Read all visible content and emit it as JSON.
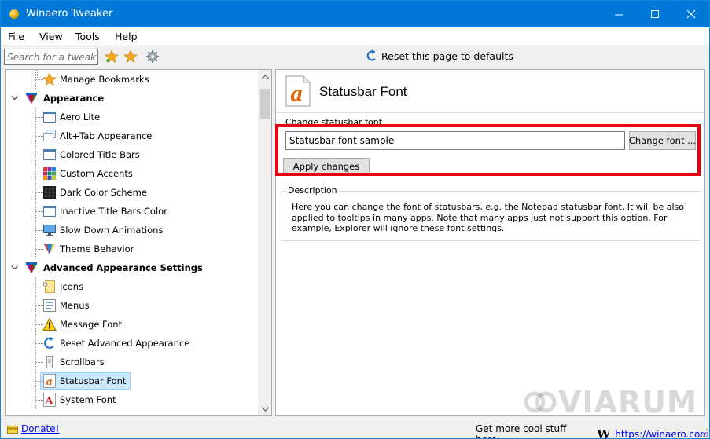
{
  "window": {
    "title": "Winaero Tweaker",
    "controls": {
      "minimize": "minimize",
      "maximize": "maximize",
      "close": "close"
    }
  },
  "menu": [
    "File",
    "View",
    "Tools",
    "Help"
  ],
  "toolbar": {
    "search_placeholder": "Search for a tweak...",
    "reset_label": "Reset this page to defaults"
  },
  "tree": {
    "items": [
      {
        "label": "Manage Bookmarks",
        "level": 1,
        "icon": "star-icon"
      },
      {
        "label": "Appearance",
        "level": 0,
        "icon": "appearance-icon",
        "expanded": true
      },
      {
        "label": "Aero Lite",
        "level": 1,
        "icon": "window-icon"
      },
      {
        "label": "Alt+Tab Appearance",
        "level": 1,
        "icon": "alttab-icon"
      },
      {
        "label": "Colored Title Bars",
        "level": 1,
        "icon": "window-icon"
      },
      {
        "label": "Custom Accents",
        "level": 1,
        "icon": "palette-grid-icon"
      },
      {
        "label": "Dark Color Scheme",
        "level": 1,
        "icon": "dark-grid-icon"
      },
      {
        "label": "Inactive Title Bars Color",
        "level": 1,
        "icon": "window-icon"
      },
      {
        "label": "Slow Down Animations",
        "level": 1,
        "icon": "monitor-icon"
      },
      {
        "label": "Theme Behavior",
        "level": 1,
        "icon": "theme-icon"
      },
      {
        "label": "Advanced Appearance Settings",
        "level": 0,
        "icon": "appearance-icon",
        "expanded": true
      },
      {
        "label": "Icons",
        "level": 1,
        "icon": "icons-icon"
      },
      {
        "label": "Menus",
        "level": 1,
        "icon": "menus-icon"
      },
      {
        "label": "Message Font",
        "level": 1,
        "icon": "warning-icon"
      },
      {
        "label": "Reset Advanced Appearance",
        "level": 1,
        "icon": "reset-icon"
      },
      {
        "label": "Scrollbars",
        "level": 1,
        "icon": "scrollbar-icon"
      },
      {
        "label": "Statusbar Font",
        "level": 1,
        "icon": "font-a-icon",
        "selected": true
      },
      {
        "label": "System Font",
        "level": 1,
        "icon": "font-A-icon"
      }
    ]
  },
  "page": {
    "title": "Statusbar Font",
    "field_label": "Change statusbar font",
    "font_sample": "Statusbar font sample",
    "change_font_label": "Change font ...",
    "apply_label": "Apply changes",
    "description_legend": "Description",
    "description_text": "Here you can change the font of statusbars, e.g. the Notepad statusbar font. It will be also applied to tooltips in many apps. Note that many apps just not support this option. For example, Explorer will ignore these font settings."
  },
  "watermark": "VIARUM",
  "statusbar": {
    "donate": "Donate!",
    "promo": "Get more cool stuff here:",
    "promo_logo": "W",
    "url": "https://winaero.com"
  },
  "colors": {
    "titlebar": "#0078d7",
    "highlight": "#e8000e",
    "selection": "#cce8ff",
    "link": "#0000ff"
  }
}
